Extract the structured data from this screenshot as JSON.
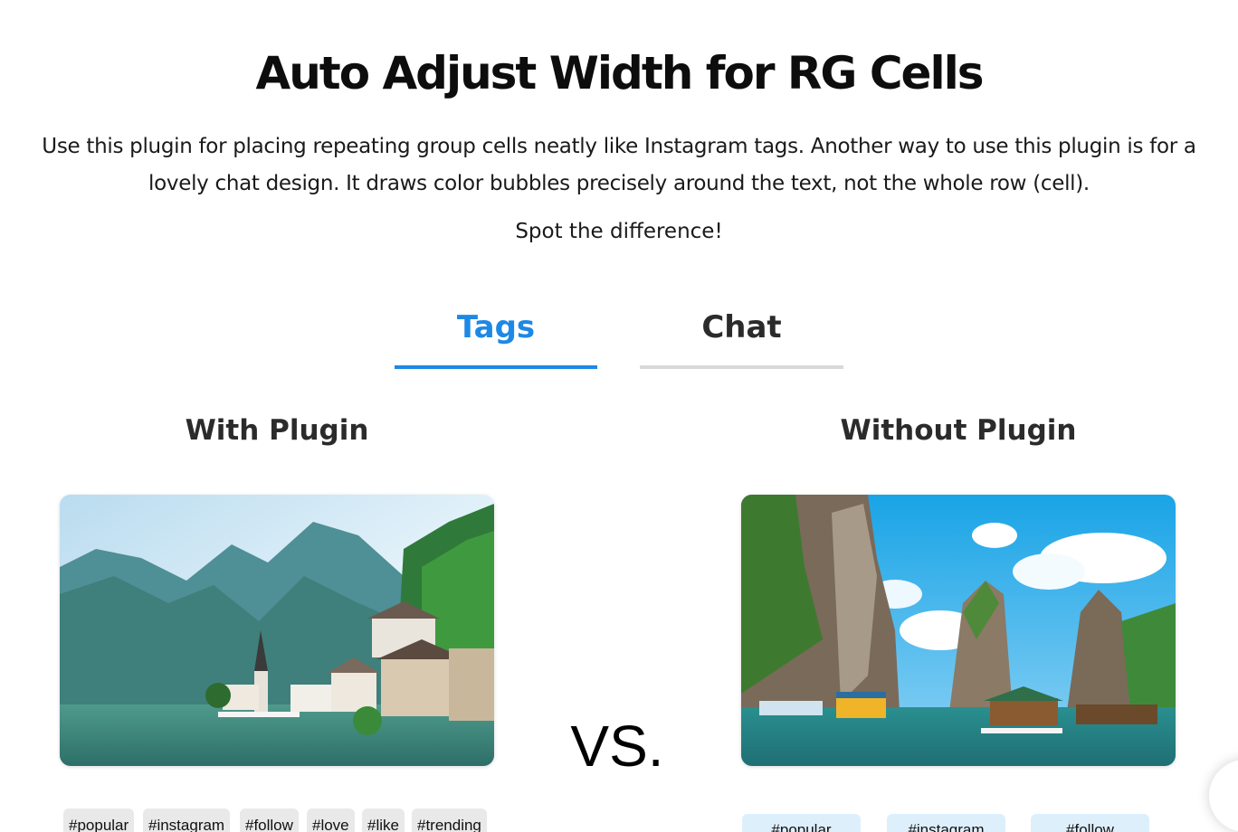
{
  "header": {
    "title": "Auto Adjust Width for RG Cells",
    "description": "Use this plugin for placing repeating group cells neatly like Instagram tags. Another way to use this plugin is for a lovely chat design. It draws color bubbles precisely around the text, not the whole row (cell).",
    "subtitle": "Spot the difference!"
  },
  "tabs": [
    {
      "label": "Tags",
      "active": true
    },
    {
      "label": "Chat",
      "active": false
    }
  ],
  "comparison": {
    "left": {
      "title": "With Plugin",
      "image": "alpine-lake-village-photo",
      "tags": [
        "#popular",
        "#instagram",
        "#follow",
        "#love",
        "#like",
        "#trending"
      ]
    },
    "vs_label": "VS.",
    "right": {
      "title": "Without Plugin",
      "image": "bay-karst-islands-photo",
      "tags": [
        "#popular",
        "#instagram",
        "#follow"
      ]
    }
  },
  "colors": {
    "accent": "#1e88e5",
    "inactive_tab_underline": "#d9d9d9",
    "tag_bg_with_plugin": "#e9e9e9",
    "tag_bg_without_plugin": "#deeffc"
  }
}
